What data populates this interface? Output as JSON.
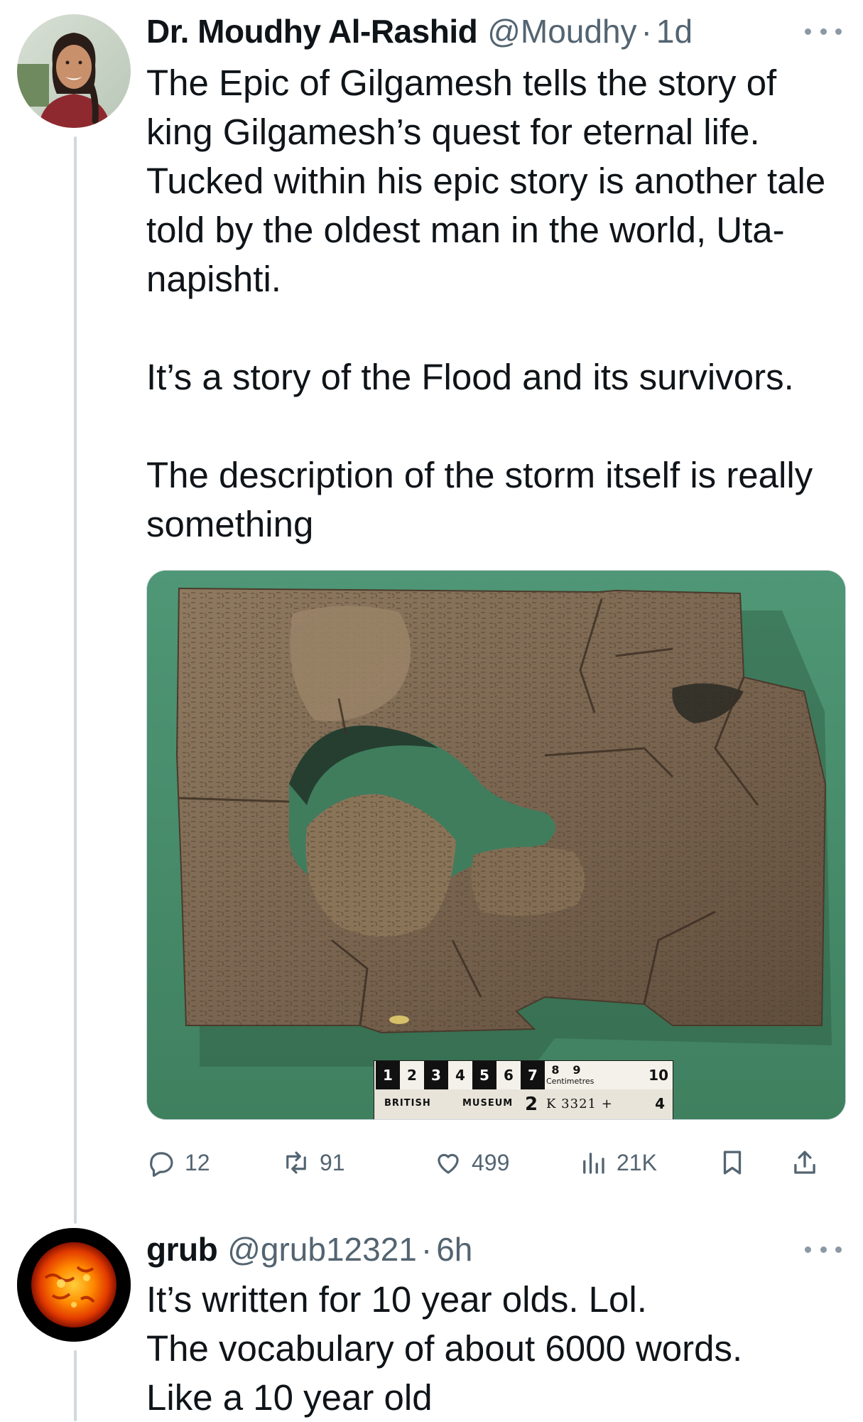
{
  "tweet1": {
    "author_name": "Dr. Moudhy Al-Rashid",
    "handle": "@Moudhy",
    "separator": "·",
    "time": "1d",
    "paragraphs": [
      "The Epic of Gilgamesh tells the story of king Gilgamesh’s quest for eternal life. Tucked within his epic story is another tale told by the oldest man in the world, Uta-napishti.",
      "It’s a story of the Flood and its survivors.",
      "The description of the storm itself is really something"
    ],
    "image": {
      "ruler_numbers": [
        "1",
        "2",
        "3",
        "4",
        "5",
        "6",
        "7",
        "8",
        "9",
        "10"
      ],
      "ruler_unit": "Centimetres",
      "ruler_label_left": "BRITISH",
      "ruler_label_right": "MUSEUM",
      "ruler_extra_number": "2",
      "catalog_number": "K 3321 +",
      "plate_number": "4"
    },
    "actions": {
      "replies": "12",
      "retweets": "91",
      "likes": "499",
      "views": "21K"
    }
  },
  "tweet2": {
    "author_name": "grub",
    "handle": "@grub12321",
    "separator": "·",
    "time": "6h",
    "lines": [
      "It’s written for 10 year olds. Lol.",
      "The vocabulary of about 6000 words.",
      "Like a 10 year old"
    ]
  },
  "colors": {
    "text": "#0f1419",
    "secondary": "#536471",
    "thread_line": "#cfd9de",
    "image_background": "#4a8f6d"
  }
}
